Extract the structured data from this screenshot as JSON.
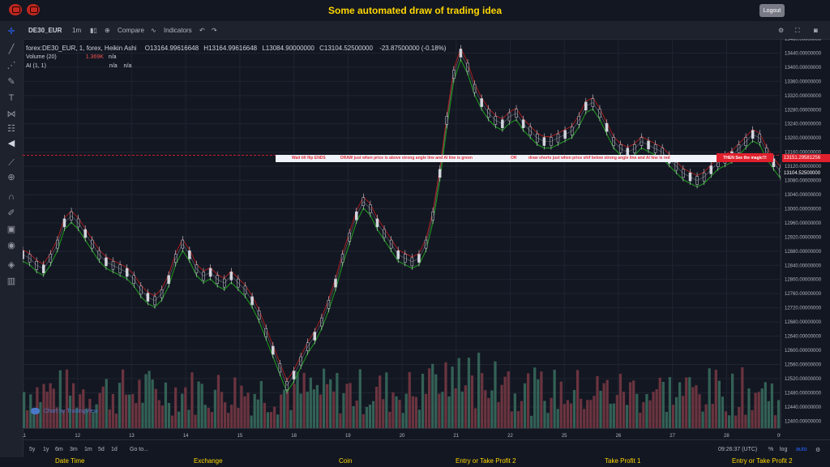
{
  "app": {
    "title": "Some automated draw of trading idea",
    "logout_label": "Logout"
  },
  "toolbar": {
    "symbol": "DE30_EUR",
    "interval": "1m",
    "compare_label": "Compare",
    "indicators_label": "Indicators"
  },
  "legend": {
    "symbol_line": "forex:DE30_EUR, 1, forex, Heikin Ashi",
    "open": "O13164.99616648",
    "high": "H13164.99616648",
    "low": "L13084.90000000",
    "close": "C13104.52500000",
    "change": "-23.87500000 (-0.18%)",
    "volume_label": "Volume (20)",
    "volume_value": "1.369K",
    "volume_na": "n/a",
    "ai_label": "AI (1, 1)",
    "ai_na1": "n/a",
    "ai_na2": "n/a"
  },
  "banner": {
    "text1": "Wait till flip ENDS",
    "text2": "DRAW just when price is above strong angle line and AI line is green",
    "or_label": "OR",
    "text3": "draw shorts just when price shif below strong angle line and AI line is red",
    "cta": "THEN See the magic!!!"
  },
  "price_axis": {
    "labels": [
      "13480.00000000",
      "13440.00000000",
      "13400.00000000",
      "13360.00000000",
      "13320.00000000",
      "13280.00000000",
      "13240.00000000",
      "13200.00000000",
      "13160.00000000",
      "13120.00000000",
      "13080.00000000",
      "13040.00000000",
      "13000.00000000",
      "12960.00000000",
      "12920.00000000",
      "12880.00000000",
      "12840.00000000",
      "12800.00000000",
      "12760.00000000",
      "12720.00000000",
      "12680.00000000",
      "12640.00000000",
      "12600.00000000",
      "12560.00000000",
      "12520.00000000",
      "12480.00000000",
      "12440.00000000",
      "12400.00000000"
    ],
    "marker_red": "13151.29581256",
    "marker_dark": "13104.52500000"
  },
  "time_axis": {
    "labels": [
      "11",
      "12",
      "13",
      "14",
      "15",
      "18",
      "19",
      "20",
      "21",
      "22",
      "25",
      "26",
      "27",
      "28",
      "09:"
    ]
  },
  "bottom": {
    "ranges": [
      "5y",
      "1y",
      "6m",
      "3m",
      "1m",
      "5d",
      "1d"
    ],
    "goto_label": "Go to...",
    "clock": "09:26:37 (UTC)",
    "pct": "%",
    "log": "log",
    "auto": "auto"
  },
  "watermark": "Chart by TradingView",
  "footer": {
    "cols": [
      "Date Time",
      "Exchange",
      "Coin",
      "Entry or Take Profit 2",
      "Take Profit 1",
      "Entry or Take Profit 2"
    ]
  },
  "colors": {
    "background": "#131722",
    "up": "#26a69a",
    "down": "#ef5350",
    "ai_green": "#1e8c1e",
    "ai_red": "#a61c1c",
    "title_yellow": "#ffd700"
  },
  "chart_data": {
    "type": "line",
    "title": "",
    "series": [
      {
        "values": [
          12870,
          12860,
          12840,
          12830,
          12860,
          12900,
          12960,
          12980,
          12960,
          12930,
          12900,
          12870,
          12850,
          12840,
          12830,
          12820,
          12800,
          12770,
          12750,
          12740,
          12760,
          12800,
          12860,
          12900,
          12870,
          12830,
          12810,
          12820,
          12800,
          12790,
          12810,
          12790,
          12770,
          12740,
          12700,
          12650,
          12600,
          12550,
          12500,
          12530,
          12570,
          12610,
          12640,
          12680,
          12730,
          12790,
          12860,
          12920,
          12980,
          13020,
          13000,
          12960,
          12930,
          12900,
          12870,
          12860,
          12850,
          12860,
          12900,
          12980,
          13100,
          13250,
          13380,
          13440,
          13400,
          13340,
          13300,
          13270,
          13250,
          13240,
          13260,
          13270,
          13240,
          13220,
          13200,
          13190,
          13190,
          13200,
          13210,
          13220,
          13250,
          13290,
          13300,
          13270,
          13230,
          13190,
          13170,
          13160,
          13170,
          13190,
          13180,
          13170,
          13160,
          13140,
          13120,
          13100,
          13090,
          13080,
          13090,
          13110,
          13130,
          13140,
          13150,
          13170,
          13190,
          13210,
          13200,
          13160,
          13130,
          13104
        ]
      }
    ],
    "ylim": [
      12380,
      13480
    ]
  }
}
